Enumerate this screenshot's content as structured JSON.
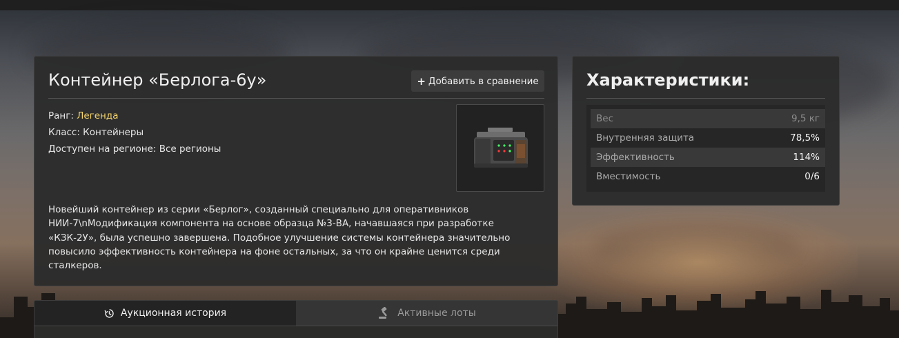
{
  "item": {
    "title": "Контейнер «Берлога-6у»",
    "compare_label": "Добавить в сравнение",
    "rank_label": "Ранг:",
    "rank_value": "Легенда",
    "class_line": "Класс: Контейнеры",
    "region_line": "Доступен на регионе: Все регионы",
    "description": "Новейший контейнер из серии «Берлог», созданный специально для оперативников НИИ-7\\nМодификация компонента на основе образца №3-ВА, начавшаяся при разработке «КЗК-2У», была успешно завершена. Подобное улучшение системы контейнера значительно повысило эффективность контейнера на фоне остальных, за что он крайне ценится среди сталкеров."
  },
  "tabs": [
    {
      "label": "Аукционная история",
      "icon": "history-icon",
      "active": true
    },
    {
      "label": "Активные лоты",
      "icon": "gavel-icon",
      "active": false
    }
  ],
  "stats": {
    "title": "Характеристики:",
    "rows": [
      {
        "name": "Вес",
        "value": "9,5 кг"
      },
      {
        "name": "Внутренняя защита",
        "value": "78,5%"
      },
      {
        "name": "Эффективность",
        "value": "114%"
      },
      {
        "name": "Вместимость",
        "value": "0/6"
      }
    ]
  },
  "colors": {
    "rank_legend": "#f3d36b",
    "panel_bg": "#2c2c2c"
  }
}
